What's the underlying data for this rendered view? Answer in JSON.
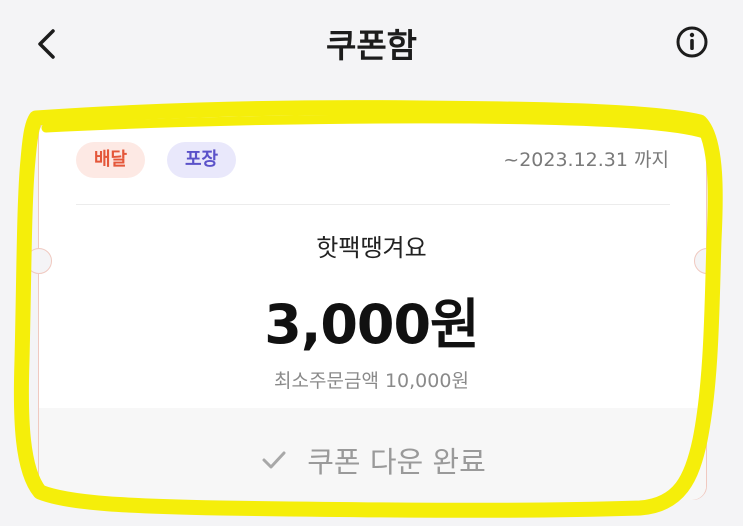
{
  "header": {
    "title": "쿠폰함",
    "back_icon": "chevron-left-icon",
    "info_icon": "info-circle-icon"
  },
  "coupon": {
    "tags": [
      {
        "label": "배달",
        "color": "#e4573a",
        "bg": "#fde9e4"
      },
      {
        "label": "포장",
        "color": "#5b52c9",
        "bg": "#e9e8fb"
      }
    ],
    "expiry": "~2023.12.31 까지",
    "name": "핫팩땡겨요",
    "amount": "3,000원",
    "min_order": "최소주문금액 10,000원",
    "download_label": "쿠폰 다운 완료",
    "download_icon": "check-icon"
  },
  "colors": {
    "highlight": "#f5ee0a",
    "accent_border": "#f0c9c0"
  }
}
